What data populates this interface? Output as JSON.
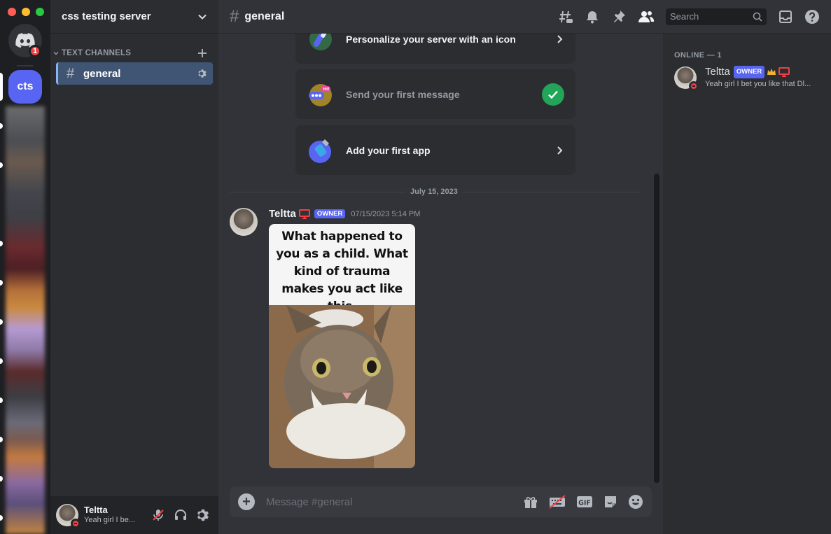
{
  "server": {
    "name": "css testing server",
    "short": "cts",
    "home_badge": "1"
  },
  "channels": {
    "category": "TEXT CHANNELS",
    "items": [
      {
        "name": "general"
      }
    ]
  },
  "user": {
    "name": "Teltta",
    "status": "Yeah girl I be..."
  },
  "chat": {
    "channel": "general",
    "search_placeholder": "Search",
    "cards": [
      {
        "label": "Personalize your server with an icon",
        "done": false
      },
      {
        "label": "Send your first message",
        "done": true
      },
      {
        "label": "Add your first app",
        "done": false
      }
    ],
    "date_divider": "July 15, 2023",
    "message": {
      "author": "Teltta",
      "badge": "OWNER",
      "timestamp": "07/15/2023 5:14 PM",
      "image_text": "What happened to you as a child. What kind of trauma makes you act like this."
    },
    "composer_placeholder": "Message #general",
    "gif_label": "GIF"
  },
  "members": {
    "heading": "ONLINE — 1",
    "list": [
      {
        "name": "Teltta",
        "badge": "OWNER",
        "status": "Yeah girl I bet you like that Dl..."
      }
    ]
  },
  "colors": {
    "accent": "#5865f2",
    "success": "#23a559",
    "danger": "#f23f43",
    "selected_channel": "#3f5573"
  }
}
